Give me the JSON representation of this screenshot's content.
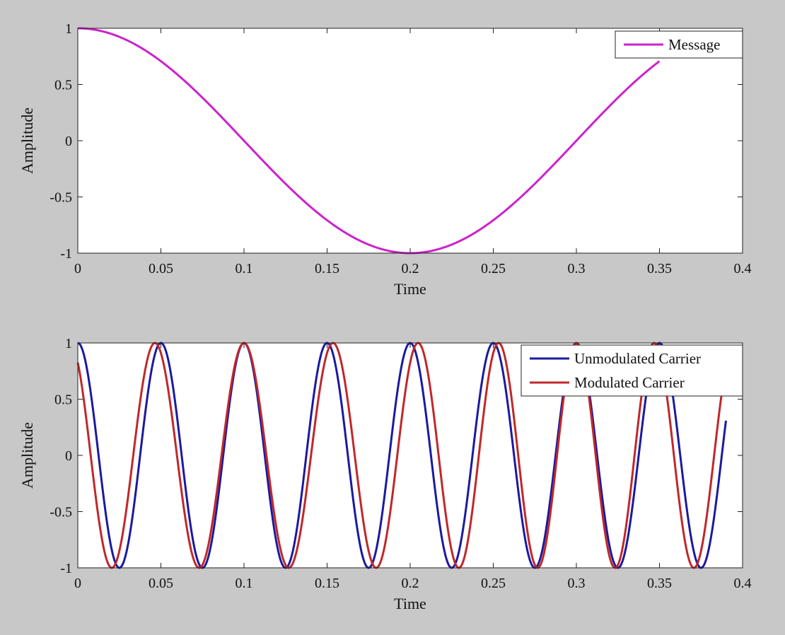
{
  "colors": {
    "figure_background": "#c8c8c8",
    "axes_background": "#ffffff",
    "message": "#cc22cc",
    "unmodulated_carrier": "#1a1aa0",
    "modulated_carrier": "#c0282a"
  },
  "chart_data": [
    {
      "type": "line",
      "title": "",
      "xlabel": "Time",
      "ylabel": "Amplitude",
      "xlim": [
        0,
        0.4
      ],
      "ylim": [
        -1,
        1
      ],
      "xticks": [
        "0",
        "0.05",
        "0.1",
        "0.15",
        "0.2",
        "0.25",
        "0.3",
        "0.35",
        "0.4"
      ],
      "yticks": [
        "1",
        "0.5",
        "0",
        "-0.5",
        "-1"
      ],
      "grid": false,
      "legend_position": "top-right",
      "series": [
        {
          "name": "Message",
          "color": "#cc22cc",
          "function": "cos(2*pi*f*t)",
          "frequency_hz": 2.5,
          "t_range": [
            0,
            0.35
          ]
        }
      ]
    },
    {
      "type": "line",
      "title": "",
      "xlabel": "Time",
      "ylabel": "Amplitude",
      "xlim": [
        0,
        0.4
      ],
      "ylim": [
        -1,
        1
      ],
      "xticks": [
        "0",
        "0.05",
        "0.1",
        "0.15",
        "0.2",
        "0.25",
        "0.3",
        "0.35",
        "0.4"
      ],
      "yticks": [
        "1",
        "0.5",
        "0",
        "-0.5",
        "-1"
      ],
      "grid": false,
      "legend_position": "top-right",
      "series": [
        {
          "name": "Unmodulated Carrier",
          "color": "#1a1aa0",
          "function": "cos(2*pi*fc*t)",
          "carrier_frequency_hz": 20,
          "t_range": [
            0,
            0.39
          ]
        },
        {
          "name": "Modulated Carrier",
          "color": "#c0282a",
          "function": "cos(2*pi*fc*t + beta*cos(2*pi*fm*t))",
          "carrier_frequency_hz": 20,
          "message_frequency_hz": 2.5,
          "modulation_index": 0.6,
          "t_range": [
            0,
            0.39
          ]
        }
      ]
    }
  ]
}
